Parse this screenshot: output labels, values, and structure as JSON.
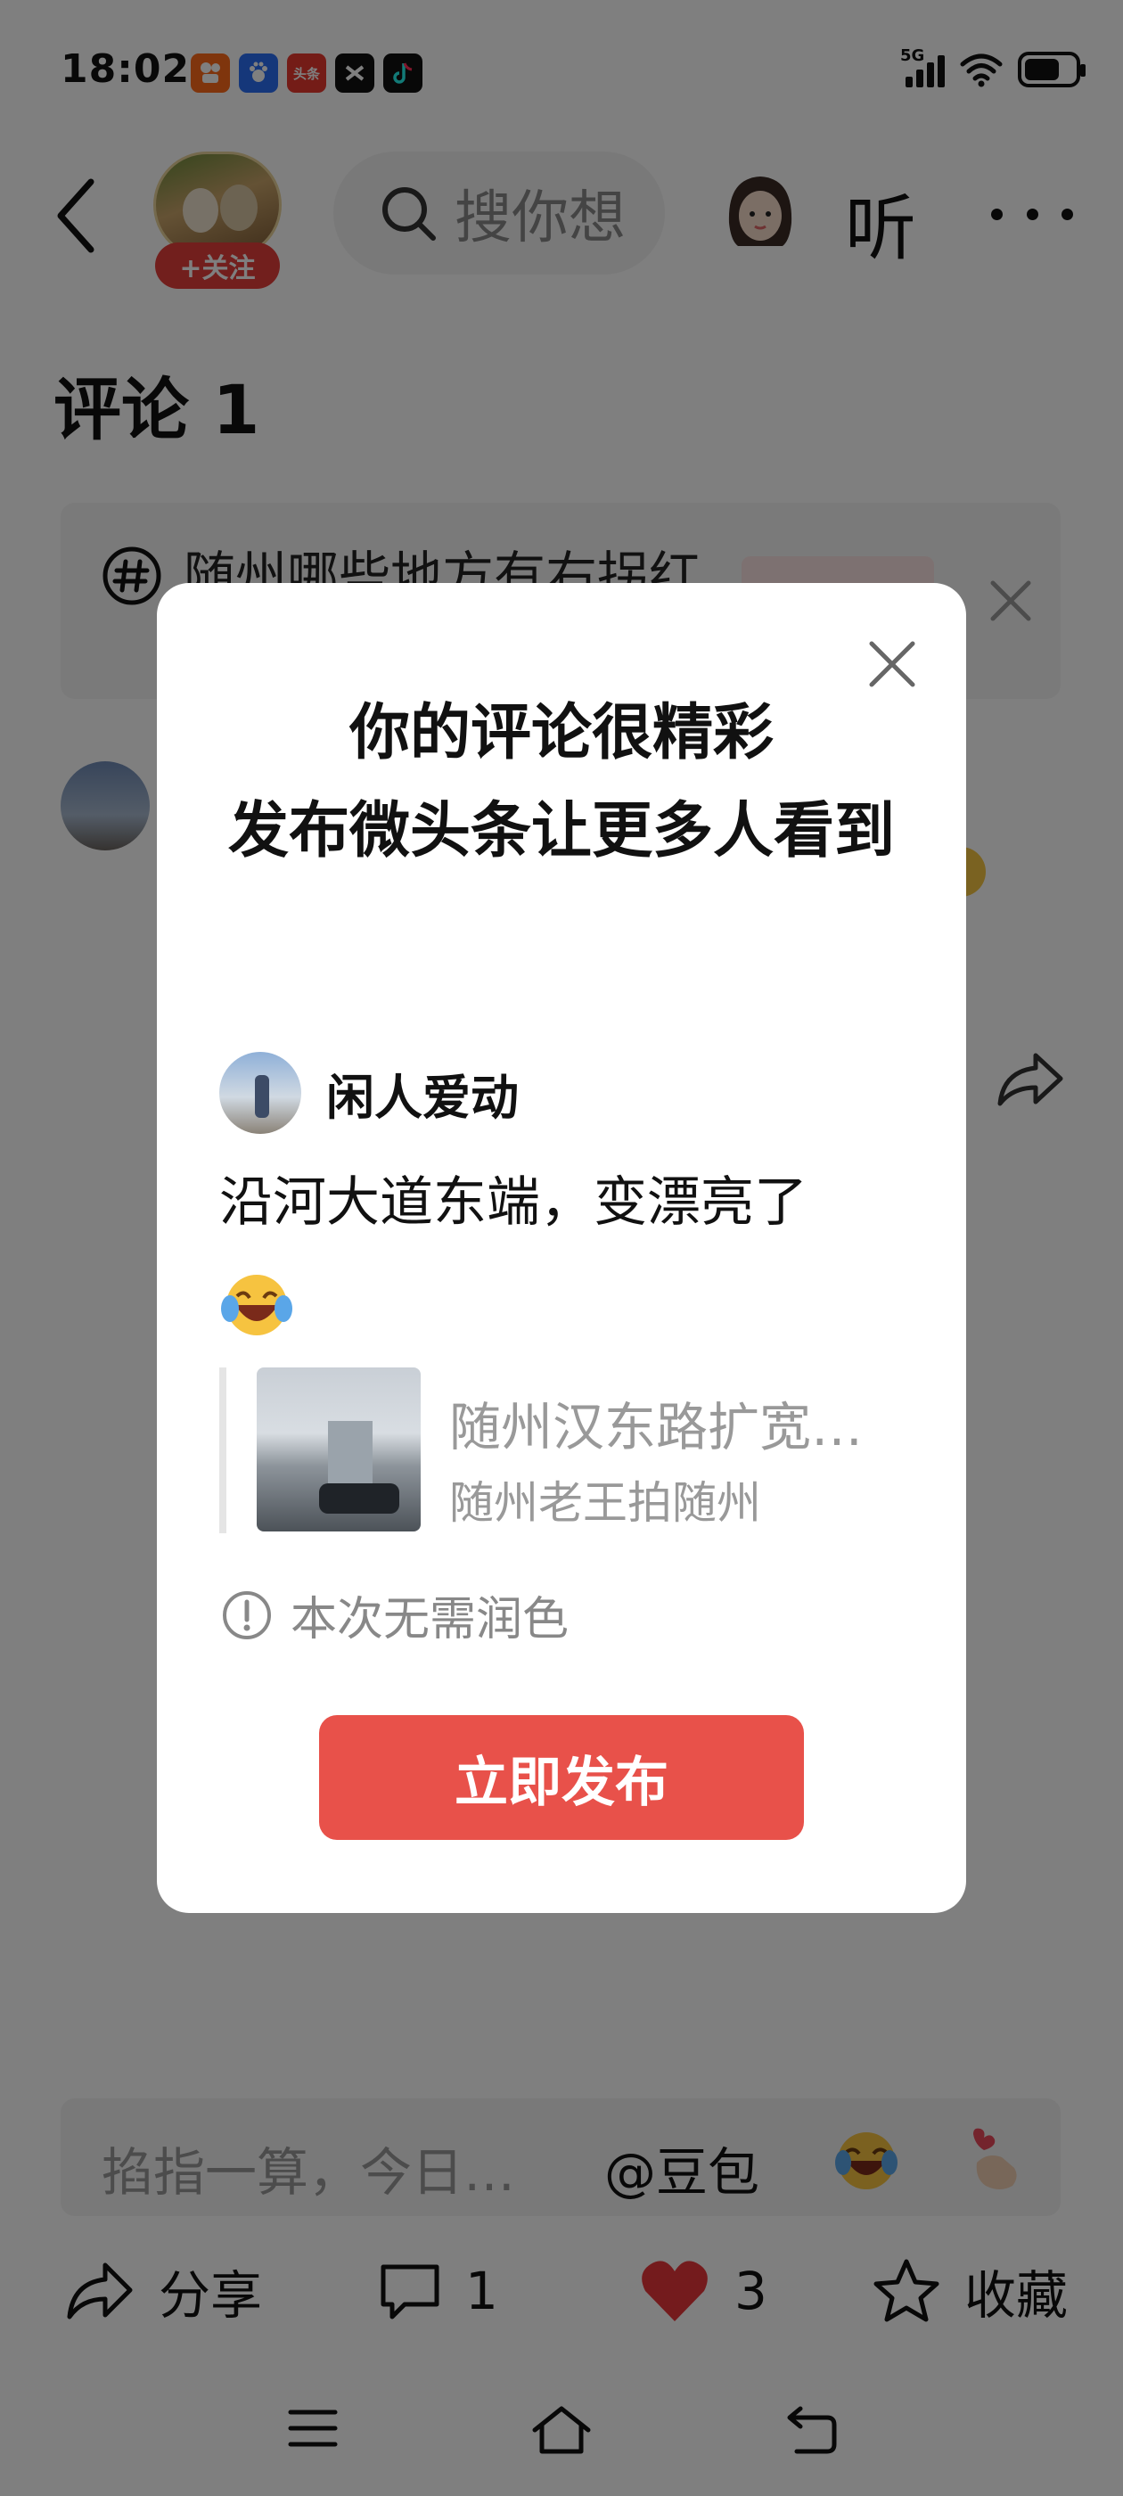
{
  "status_bar": {
    "time": "18:02",
    "network": "5G",
    "apps": [
      {
        "name": "kuaishou-app-icon",
        "color": "#ff6a1a",
        "label": ""
      },
      {
        "name": "baidu-app-icon",
        "color": "#2b6ef5",
        "label": ""
      },
      {
        "name": "toutiao-app-icon",
        "color": "#e8392f",
        "label": "头条"
      },
      {
        "name": "capcut-app-icon",
        "color": "#111111",
        "label": ""
      },
      {
        "name": "tiktok-app-icon",
        "color": "#111111",
        "label": ""
      }
    ]
  },
  "top_nav": {
    "follow_label": "+关注",
    "search_placeholder": "搜你想",
    "listen_label": "听"
  },
  "comments": {
    "title": "评论 1",
    "topic_text": "随州哪些地方有右拐红"
  },
  "modal": {
    "title_line1": "你的评论很精彩",
    "title_line2": "发布微头条让更多人看到",
    "author_name": "闲人爱动",
    "post_text": "沿河大道东端，变漂亮了",
    "quote_title": "随州汉东路扩宽…",
    "quote_source": "随州老王拍随州",
    "polish_note": "本次无需润色",
    "publish_label": "立即发布"
  },
  "bottom_bar": {
    "input_placeholder": "掐指一算，今日…",
    "mention_label": "@豆包",
    "share_label": "分享",
    "comment_count": "1",
    "like_count": "3",
    "favorite_label": "收藏"
  },
  "colors": {
    "accent_red": "#e8514a",
    "follow_red": "#e43f3b",
    "like_red": "#e8373a"
  }
}
